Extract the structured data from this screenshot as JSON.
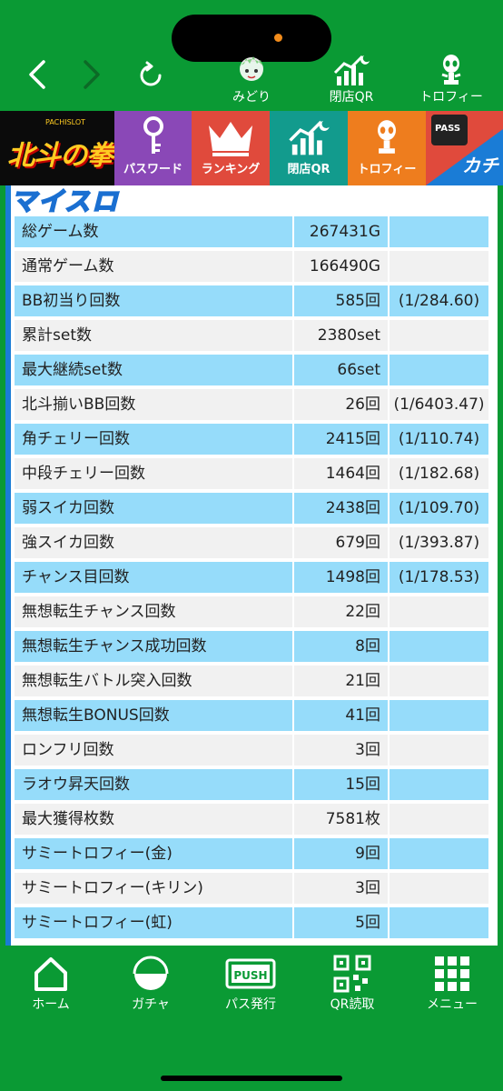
{
  "top_nav": {
    "back_glyph": "‹",
    "forward_glyph": "›",
    "reload_glyph": "↻",
    "items": [
      {
        "label": "みどり",
        "icon": "character-icon"
      },
      {
        "label": "閉店QR",
        "icon": "chart-moon-icon"
      },
      {
        "label": "トロフィー",
        "icon": "trophy-alien-icon"
      }
    ]
  },
  "menu": {
    "logo_text": "北斗の拳",
    "logo_sub": "PACHISLOT",
    "tiles": [
      {
        "label": "パスワード",
        "color": "#8a48b7",
        "icon": "key-icon"
      },
      {
        "label": "ランキング",
        "color": "#e04a3c",
        "icon": "crown-icon"
      },
      {
        "label": "閉店QR",
        "color": "#129b8d",
        "icon": "chart-moon-icon"
      },
      {
        "label": "トロフィー",
        "color": "#ee7d1e",
        "icon": "trophy-alien-icon"
      }
    ],
    "pass_label": "PASS",
    "kachi_label": "カチ"
  },
  "content": {
    "brand": "マイスロ",
    "rows": [
      {
        "label": "総ゲーム数",
        "value": "267431G",
        "ratio": ""
      },
      {
        "label": "通常ゲーム数",
        "value": "166490G",
        "ratio": ""
      },
      {
        "label": "BB初当り回数",
        "value": "585回",
        "ratio": "(1/284.60)"
      },
      {
        "label": "累計set数",
        "value": "2380set",
        "ratio": ""
      },
      {
        "label": "最大継続set数",
        "value": "66set",
        "ratio": ""
      },
      {
        "label": "北斗揃いBB回数",
        "value": "26回",
        "ratio": "(1/6403.47)"
      },
      {
        "label": "角チェリー回数",
        "value": "2415回",
        "ratio": "(1/110.74)"
      },
      {
        "label": "中段チェリー回数",
        "value": "1464回",
        "ratio": "(1/182.68)"
      },
      {
        "label": "弱スイカ回数",
        "value": "2438回",
        "ratio": "(1/109.70)"
      },
      {
        "label": "強スイカ回数",
        "value": "679回",
        "ratio": "(1/393.87)"
      },
      {
        "label": "チャンス目回数",
        "value": "1498回",
        "ratio": "(1/178.53)"
      },
      {
        "label": "無想転生チャンス回数",
        "value": "22回",
        "ratio": ""
      },
      {
        "label": "無想転生チャンス成功回数",
        "value": "8回",
        "ratio": ""
      },
      {
        "label": "無想転生バトル突入回数",
        "value": "21回",
        "ratio": ""
      },
      {
        "label": "無想転生BONUS回数",
        "value": "41回",
        "ratio": ""
      },
      {
        "label": "ロンフリ回数",
        "value": "3回",
        "ratio": ""
      },
      {
        "label": "ラオウ昇天回数",
        "value": "15回",
        "ratio": ""
      },
      {
        "label": "最大獲得枚数",
        "value": "7581枚",
        "ratio": ""
      },
      {
        "label": "サミートロフィー(金)",
        "value": "9回",
        "ratio": ""
      },
      {
        "label": "サミートロフィー(キリン)",
        "value": "3回",
        "ratio": ""
      },
      {
        "label": "サミートロフィー(虹)",
        "value": "5回",
        "ratio": ""
      }
    ]
  },
  "bottom_nav": [
    {
      "label": "ホーム",
      "icon": "home-icon"
    },
    {
      "label": "ガチャ",
      "icon": "gacha-icon"
    },
    {
      "label": "パス発行",
      "icon": "push-icon",
      "badge": "PUSH"
    },
    {
      "label": "QR読取",
      "icon": "qr-icon"
    },
    {
      "label": "メニュー",
      "icon": "grid-menu-icon"
    }
  ]
}
